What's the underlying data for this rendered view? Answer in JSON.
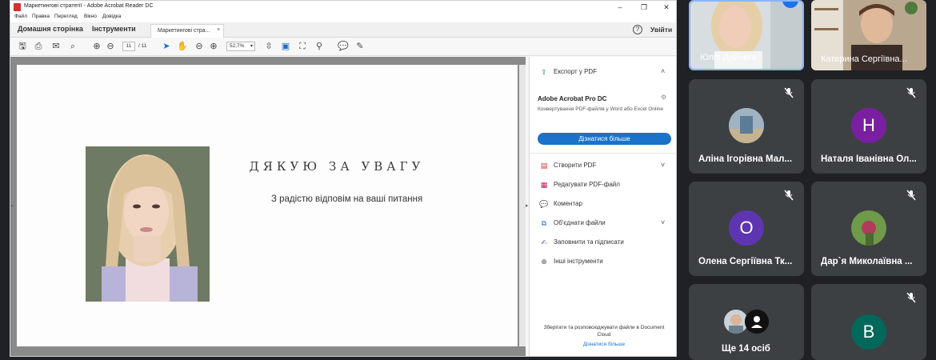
{
  "acrobat": {
    "window_title": "Маркетингові стратегії - Adobe Acrobat Reader DC",
    "menu": [
      "Файл",
      "Правка",
      "Перегляд",
      "Вікно",
      "Довідка"
    ],
    "tabs": {
      "home": "Домашня сторінка",
      "tools": "Інструменти",
      "document": "Маркетингові стра...",
      "close": "×"
    },
    "signin": "Увійти",
    "help": "?",
    "toolbar": {
      "page_current": "11",
      "page_total": "/ 11",
      "zoom": "52,7%"
    },
    "document": {
      "heading": "ДЯКУЮ ЗА УВАГУ",
      "subtitle": "З радістю відповім на ваші питання"
    },
    "right_pane": {
      "export": "Експорт у PDF",
      "promo_title": "Adobe Acrobat Pro DC",
      "promo_text": "Конвертування PDF-файлів у Word або Excel Online",
      "promo_button": "Дізнатися більше",
      "tools": [
        {
          "label": "Створити PDF",
          "icon": "create-pdf-icon",
          "color": "#d93025"
        },
        {
          "label": "Редагувати PDF-файл",
          "icon": "edit-pdf-icon",
          "color": "#c2185b"
        },
        {
          "label": "Коментар",
          "icon": "comment-icon",
          "color": "#f2b200"
        },
        {
          "label": "Об'єднати файли",
          "icon": "combine-files-icon",
          "color": "#1a6ec8"
        },
        {
          "label": "Заповнити та підписати",
          "icon": "fill-sign-icon",
          "color": "#7b5ea7"
        },
        {
          "label": "Інші інструменти",
          "icon": "more-tools-icon",
          "color": "#555555"
        }
      ],
      "cloud_text": "Зберігати та розповсюджувати файли в Document Cloud",
      "cloud_link": "Дізнатися більше"
    }
  },
  "meet": {
    "participants": [
      {
        "name": "Юлія Дейнега"
      },
      {
        "name": "Катерина Сергіївна..."
      },
      {
        "name": "Аліна Ігорівна Мал..."
      },
      {
        "name": "Наталя Іванівна Ол...",
        "initial": "Н",
        "color": "#7b1fa2"
      },
      {
        "name": "Олена Сергіївна Тк...",
        "initial": "О",
        "color": "#5e35b1"
      },
      {
        "name": "Дар`я Миколаївна ..."
      },
      {
        "name": "Ще 14 осіб"
      },
      {
        "initial": "В",
        "color": "#00695c"
      }
    ]
  },
  "colors": {
    "accent": "#1a73c8",
    "meet_bg": "#202124",
    "tile_bg": "#3c4043"
  }
}
